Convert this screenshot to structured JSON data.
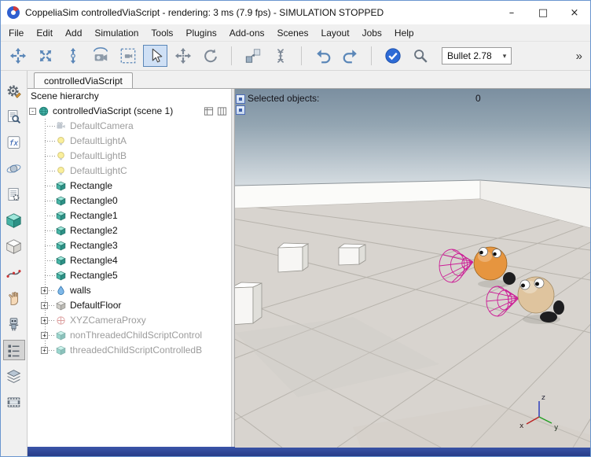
{
  "window": {
    "title": "CoppeliaSim controlledViaScript - rendering: 3 ms (7.9 fps) - SIMULATION STOPPED",
    "controls": {
      "minimize": "–",
      "maximize": "□",
      "close": "×"
    }
  },
  "menu": {
    "items": [
      "File",
      "Edit",
      "Add",
      "Simulation",
      "Tools",
      "Plugins",
      "Add-ons",
      "Scenes",
      "Layout",
      "Jobs",
      "Help"
    ]
  },
  "toolbar": {
    "buttons": [
      {
        "name": "camera-pan",
        "icon": "pan"
      },
      {
        "name": "camera-shift",
        "icon": "shift"
      },
      {
        "name": "camera-zoom",
        "icon": "zoomcam"
      },
      {
        "name": "camera-angle",
        "icon": "camangle"
      },
      {
        "name": "fit-to-view",
        "icon": "fit"
      },
      {
        "name": "select-tool",
        "icon": "select",
        "active": true
      },
      {
        "name": "object-shift",
        "icon": "objshift"
      },
      {
        "name": "object-rotate",
        "icon": "objrotate"
      },
      {
        "sep": true
      },
      {
        "name": "assemble",
        "icon": "assemble"
      },
      {
        "name": "transfer-dna",
        "icon": "dna"
      },
      {
        "sep": true
      },
      {
        "name": "undo",
        "icon": "undo"
      },
      {
        "name": "redo",
        "icon": "redo"
      },
      {
        "sep": true
      },
      {
        "name": "real-time-toggle",
        "icon": "check"
      },
      {
        "name": "find",
        "icon": "magnifier"
      }
    ],
    "engine_selector": {
      "value": "Bullet 2.78",
      "caret": "▾"
    },
    "overflow": "»"
  },
  "side_toolbar": {
    "buttons": [
      {
        "name": "simulation-settings",
        "icon": "gear"
      },
      {
        "name": "object-properties",
        "icon": "searchdoc"
      },
      {
        "name": "scripts",
        "icon": "script"
      },
      {
        "name": "rotate-translate",
        "icon": "orbit"
      },
      {
        "name": "calculation-modules",
        "icon": "doc"
      },
      {
        "name": "shape-edit",
        "icon": "cube24"
      },
      {
        "name": "mesh-edit",
        "icon": "cubewire"
      },
      {
        "name": "path-edit",
        "icon": "path"
      },
      {
        "name": "selection-mode",
        "icon": "hand"
      },
      {
        "name": "model-browser",
        "icon": "robot"
      },
      {
        "name": "scene-hierarchy-toggle",
        "icon": "grid",
        "active": true
      },
      {
        "name": "layers",
        "icon": "layers"
      },
      {
        "name": "video-recorder",
        "icon": "film"
      }
    ]
  },
  "tabs": {
    "active": "controlledViaScript"
  },
  "hierarchy": {
    "header": "Scene hierarchy",
    "expander_expanded": "-",
    "expander_collapsed": "+",
    "root": {
      "label": "controlledViaScript (scene 1)",
      "icon": "world"
    },
    "items": [
      {
        "label": "DefaultCamera",
        "icon": "camera",
        "grayed": true
      },
      {
        "label": "DefaultLightA",
        "icon": "light",
        "grayed": true
      },
      {
        "label": "DefaultLightB",
        "icon": "light",
        "grayed": true
      },
      {
        "label": "DefaultLightC",
        "icon": "light",
        "grayed": true
      },
      {
        "label": "Rectangle",
        "icon": "cube"
      },
      {
        "label": "Rectangle0",
        "icon": "cube"
      },
      {
        "label": "Rectangle1",
        "icon": "cube"
      },
      {
        "label": "Rectangle2",
        "icon": "cube"
      },
      {
        "label": "Rectangle3",
        "icon": "cube"
      },
      {
        "label": "Rectangle4",
        "icon": "cube"
      },
      {
        "label": "Rectangle5",
        "icon": "cube"
      },
      {
        "label": "walls",
        "icon": "drop",
        "expandable": true
      },
      {
        "label": "DefaultFloor",
        "icon": "floorcube",
        "expandable": true
      },
      {
        "label": "XYZCameraProxy",
        "icon": "dummy",
        "grayed": true,
        "expandable": true
      },
      {
        "label": "nonThreadedChildScriptControl",
        "icon": "cube",
        "grayed": true,
        "expandable": true
      },
      {
        "label": "threadedChildScriptControlledB",
        "icon": "cube",
        "grayed": true,
        "expandable": true
      }
    ]
  },
  "viewport": {
    "selected_objects_label": "Selected objects:",
    "selected_objects_count": "0",
    "axes": {
      "x": "x",
      "y": "y",
      "z": "z"
    },
    "colors": {
      "robot_a": "#e6953f",
      "robot_b": "#dfc49e",
      "sensor_wire": "#cc1d96"
    }
  }
}
